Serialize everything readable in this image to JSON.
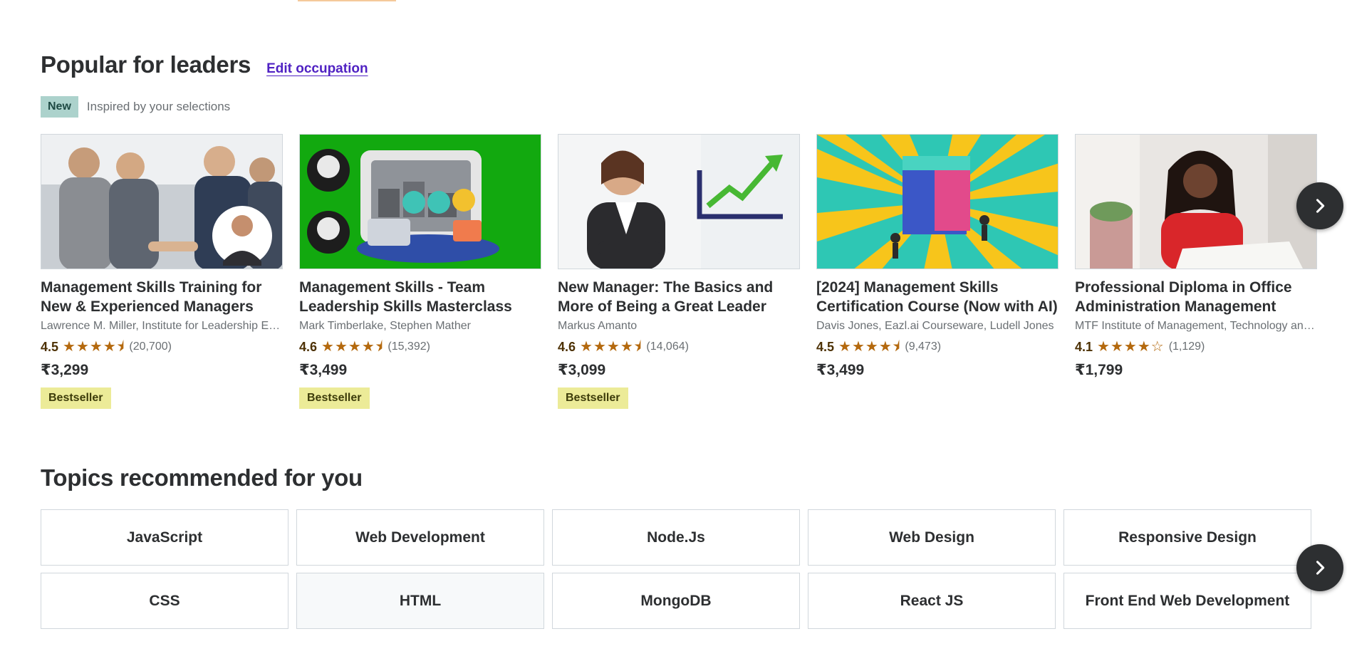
{
  "popular": {
    "title": "Popular for leaders",
    "edit_link": "Edit occupation",
    "new_badge": "New",
    "subtitle": "Inspired by your selections",
    "courses": [
      {
        "title": "Management Skills Training for New & Experienced Managers",
        "instructors": "Lawrence M. Miller, Institute for Leadership Excellence",
        "rating": "4.5",
        "stars": "★★★★⯨",
        "count": "(20,700)",
        "price": "₹3,299",
        "badge": "Bestseller"
      },
      {
        "title": "Management Skills - Team Leadership Skills Masterclass",
        "instructors": "Mark Timberlake, Stephen Mather",
        "rating": "4.6",
        "stars": "★★★★⯨",
        "count": "(15,392)",
        "price": "₹3,499",
        "badge": "Bestseller"
      },
      {
        "title": "New Manager: The Basics and More of Being a Great Leader",
        "instructors": "Markus Amanto",
        "rating": "4.6",
        "stars": "★★★★⯨",
        "count": "(14,064)",
        "price": "₹3,099",
        "badge": "Bestseller"
      },
      {
        "title": "[2024] Management Skills Certification Course (Now with AI)",
        "instructors": "Davis Jones, Eazl.ai Courseware, Ludell Jones",
        "rating": "4.5",
        "stars": "★★★★⯨",
        "count": "(9,473)",
        "price": "₹3,499",
        "badge": ""
      },
      {
        "title": "Professional Diploma in Office Administration Management",
        "instructors": "MTF Institute of Management, Technology and Finance",
        "rating": "4.1",
        "stars": "★★★★☆",
        "count": "(1,129)",
        "price": "₹1,799",
        "badge": ""
      }
    ],
    "next_icon": "chevron-right-icon"
  },
  "topics": {
    "title": "Topics recommended for you",
    "items": [
      "JavaScript",
      "Web Development",
      "Node.Js",
      "Web Design",
      "Responsive Design",
      "CSS",
      "HTML",
      "MongoDB",
      "React JS",
      "Front End Web Development"
    ],
    "next_icon": "chevron-right-icon"
  },
  "colors": {
    "text": "#2d2f31",
    "link": "#5022c3",
    "star": "#b4690e",
    "bestseller_bg": "#eceb98",
    "new_bg": "#acd2cc"
  }
}
